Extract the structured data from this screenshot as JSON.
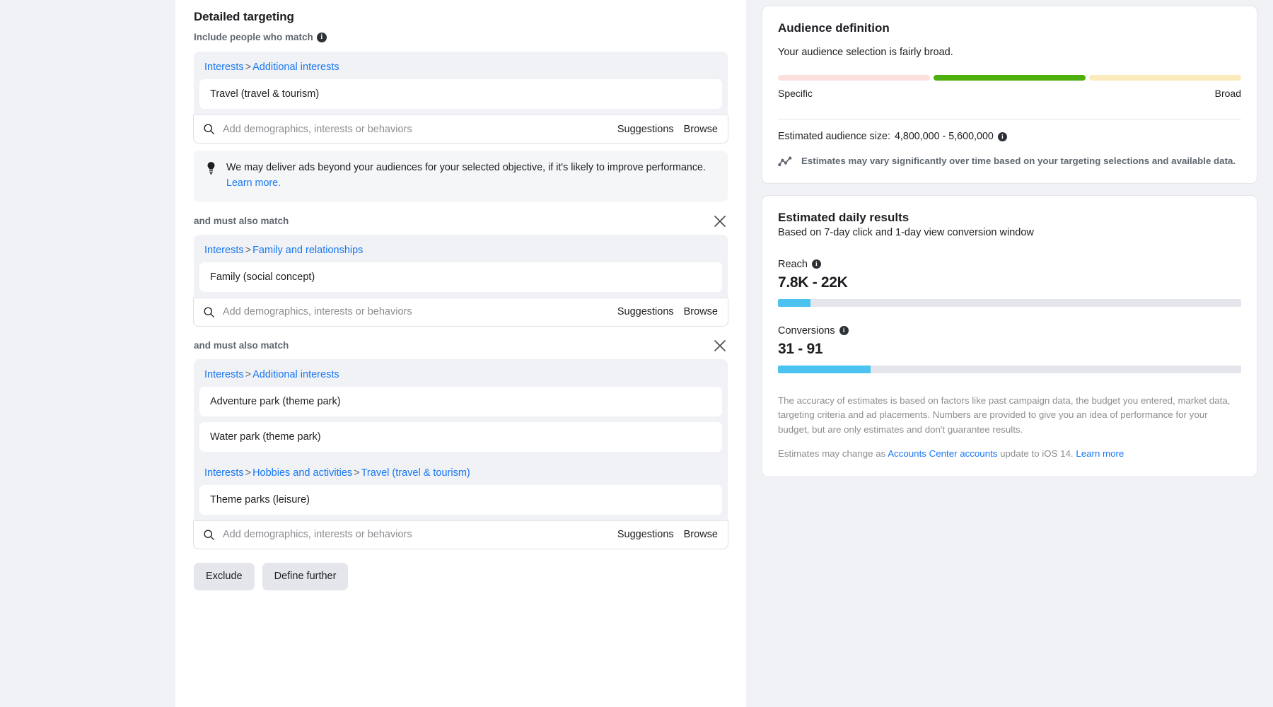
{
  "detailed_targeting": {
    "title": "Detailed targeting",
    "include_label": "Include people who match",
    "info_glyph": "i",
    "also_match_label": "and must also match",
    "search_placeholder": "Add demographics, interests or behaviors",
    "suggestions_label": "Suggestions",
    "browse_label": "Browse",
    "tip_text": "We may deliver ads beyond your audiences for your selected objective, if it's likely to improve performance. ",
    "tip_link": "Learn more.",
    "groups": [
      {
        "breadcrumbs": [
          {
            "parts": [
              "Interests",
              "Additional interests"
            ]
          }
        ],
        "chips": [
          "Travel (travel & tourism)"
        ],
        "sections": [
          {
            "crumb": [
              "Interests",
              "Additional interests"
            ],
            "chips": [
              "Travel (travel & tourism)"
            ]
          }
        ]
      },
      {
        "sections": [
          {
            "crumb": [
              "Interests",
              "Family and relationships"
            ],
            "chips": [
              "Family (social concept)"
            ]
          }
        ]
      },
      {
        "sections": [
          {
            "crumb": [
              "Interests",
              "Additional interests"
            ],
            "chips": [
              "Adventure park (theme park)",
              "Water park (theme park)"
            ]
          },
          {
            "crumb": [
              "Interests",
              "Hobbies and activities",
              "Travel (travel & tourism)"
            ],
            "chips": [
              "Theme parks (leisure)"
            ]
          }
        ]
      }
    ],
    "exclude_label": "Exclude",
    "define_further_label": "Define further"
  },
  "audience_definition": {
    "title": "Audience definition",
    "summary": "Your audience selection is fairly broad.",
    "meter": {
      "segments": [
        "#fbe0de",
        "#4caf0b",
        "#fbeabb"
      ],
      "specific_label": "Specific",
      "broad_label": "Broad"
    },
    "estimated_size_label": "Estimated audience size:",
    "estimated_size_value": "4,800,000 - 5,600,000",
    "vary_note": "Estimates may vary significantly over time based on your targeting selections and available data."
  },
  "estimated_daily_results": {
    "title": "Estimated daily results",
    "subtitle": "Based on 7-day click and 1-day view conversion window",
    "reach": {
      "label": "Reach",
      "value": "7.8K - 22K",
      "fill_percent": 7
    },
    "conversions": {
      "label": "Conversions",
      "value": "31 - 91",
      "fill_percent": 20
    },
    "accuracy_note": "The accuracy of estimates is based on factors like past campaign data, the budget you entered, market data, targeting criteria and ad placements. Numbers are provided to give you an idea of performance for your budget, but are only estimates and don't guarantee results.",
    "change_note_pre": "Estimates may change as ",
    "change_note_link1": "Accounts Center accounts",
    "change_note_mid": " update to iOS 14. ",
    "change_note_link2": "Learn more"
  },
  "colors": {
    "link": "#1877f2",
    "accent_bar": "#4cc2f1",
    "meter_green": "#4caf0b",
    "page_bg": "#f0f2f5"
  }
}
